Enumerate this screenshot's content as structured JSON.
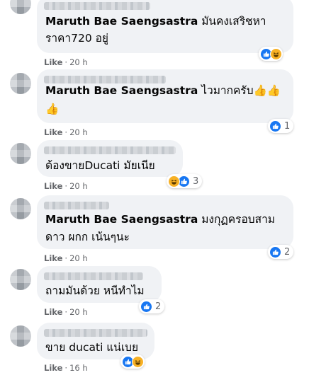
{
  "comments": [
    {
      "mention": "Maruth Bae Saengsastra",
      "line1": "มันคงเสริชหา",
      "line2": "ราคา720 อยู่",
      "like_label": "Like",
      "time": "20 h",
      "reaction_count": ""
    },
    {
      "mention": "Maruth Bae Saengsastra",
      "line1": "ไวมากครับ👍👍",
      "line2": "👍",
      "like_label": "Like",
      "time": "20 h",
      "reaction_count": "1"
    },
    {
      "line1": "ต้องขายDucati มัยเนีย",
      "like_label": "Like",
      "time": "20 h",
      "reaction_count": "3"
    },
    {
      "mention": "Maruth Bae Saengsastra",
      "line1": "มงกุฏครอบสาม",
      "line2": "ดาว ผกก เน้นๆนะ",
      "like_label": "Like",
      "time": "20 h",
      "reaction_count": "2"
    },
    {
      "line1": "ถามมันด้วย หนีทำไม",
      "like_label": "Like",
      "time": "20 h",
      "reaction_count": "2"
    },
    {
      "line1": "ขาย ducati แน่เบย",
      "like_label": "Like",
      "time": "16 h",
      "reaction_count": ""
    }
  ],
  "meta_separator": "·",
  "colors": {
    "bubble": "#f0f2f5",
    "like_blue": "#1877f2",
    "haha_yellow": "#f7b125",
    "meta_gray": "#65676b"
  }
}
